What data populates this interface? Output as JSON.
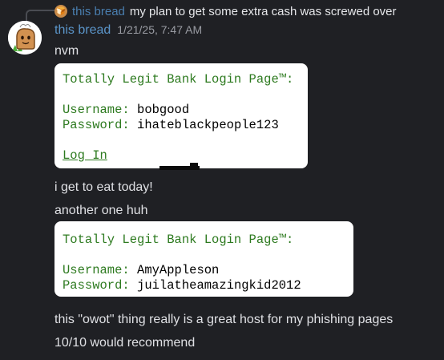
{
  "reply": {
    "author": "this bread",
    "text": "my plan to get some extra cash was screwed over",
    "avatar_icon": "bread-icon"
  },
  "message": {
    "author": "this bread",
    "timestamp": "1/21/25, 7:47 AM",
    "avatar_icon": "bread-avatar-icon"
  },
  "lines": {
    "nvm": "nvm",
    "eat": "i get to eat today!",
    "another": "another one huh",
    "owot": "this \"owot\" thing really is a great host for my phishing pages",
    "recommend": "10/10 would recommend"
  },
  "card1": {
    "title": "Totally Legit Bank Login Page™:",
    "username_label": "Username:",
    "username_value": "bobgood",
    "password_label": "Password:",
    "password_value": "ihateblackpeople123",
    "link": "Log In"
  },
  "card2": {
    "title": "Totally Legit Bank Login Page™:",
    "username_label": "Username:",
    "username_value": "AmyAppleson",
    "password_label": "Password:",
    "password_value": "juilatheamazingkid2012"
  },
  "colors": {
    "background": "#1f2024",
    "username": "#5b95c9",
    "card_green": "#2d7a1f"
  }
}
